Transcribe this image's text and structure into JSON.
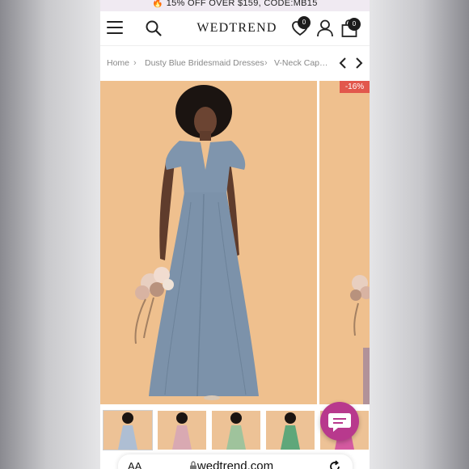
{
  "promo": {
    "text": "15% OFF OVER $159, CODE:MB15"
  },
  "header": {
    "logo": "WEDTREND",
    "wishlist_count": "0",
    "cart_count": "0"
  },
  "breadcrumb": {
    "items": [
      "Home",
      "Dusty Blue Bridesmaid Dresses",
      "V-Neck Cape ..."
    ]
  },
  "gallery": {
    "discount_badge": "-16%",
    "thumbnail_colors": [
      "#aebed3",
      "#d9a9b2",
      "#9fc39c",
      "#5fa77a",
      "#d45aa0"
    ],
    "dress_color": "#7f95ad",
    "background_color": "#efc08e"
  },
  "browser": {
    "aa_label": "AA",
    "url": "wedtrend.com"
  },
  "colors": {
    "chat_button": "#b8398d",
    "discount": "#e2574c"
  }
}
